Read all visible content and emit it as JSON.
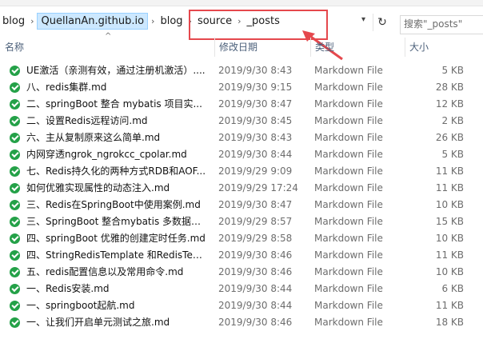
{
  "breadcrumbs": [
    "blog",
    "QuellanAn.github.io",
    "blog",
    "source",
    "_posts"
  ],
  "search": {
    "placeholder": "搜索\"_posts\""
  },
  "columns": {
    "name": "名称",
    "date": "修改日期",
    "type": "类型",
    "size": "大小"
  },
  "colors": {
    "highlight": "#e5484d",
    "check": "#24a148",
    "header_text": "#4c607a"
  },
  "icons": {
    "file": "green-check-icon",
    "refresh": "refresh-icon",
    "dropdown": "chevron-down-icon"
  },
  "files": [
    {
      "name": "UE激活（亲测有效，通过注册机激活）....",
      "date": "2019/9/30 8:43",
      "type": "Markdown File",
      "size": "5 KB"
    },
    {
      "name": "八、redis集群.md",
      "date": "2019/9/30 9:15",
      "type": "Markdown File",
      "size": "28 KB"
    },
    {
      "name": "二、springBoot 整合 mybatis 项目实...",
      "date": "2019/9/30 8:47",
      "type": "Markdown File",
      "size": "12 KB"
    },
    {
      "name": "二、设置Redis远程访问.md",
      "date": "2019/9/30 8:45",
      "type": "Markdown File",
      "size": "2 KB"
    },
    {
      "name": "六、主从复制原来这么简单.md",
      "date": "2019/9/30 8:43",
      "type": "Markdown File",
      "size": "26 KB"
    },
    {
      "name": "内网穿透ngrok_ngrokcc_cpolar.md",
      "date": "2019/9/30 8:44",
      "type": "Markdown File",
      "size": "5 KB"
    },
    {
      "name": "七、Redis持久化的两种方式RDB和AOF...",
      "date": "2019/9/29 9:09",
      "type": "Markdown File",
      "size": "11 KB"
    },
    {
      "name": "如何优雅实现属性的动态注入.md",
      "date": "2019/9/29 17:24",
      "type": "Markdown File",
      "size": "11 KB"
    },
    {
      "name": "三、Redis在SpringBoot中使用案例.md",
      "date": "2019/9/30 8:47",
      "type": "Markdown File",
      "size": "10 KB"
    },
    {
      "name": "三、SpringBoot 整合mybatis 多数据源...",
      "date": "2019/9/29 8:57",
      "type": "Markdown File",
      "size": "15 KB"
    },
    {
      "name": "四、springBoot 优雅的创建定时任务.md",
      "date": "2019/9/29 8:58",
      "type": "Markdown File",
      "size": "10 KB"
    },
    {
      "name": "四、StringRedisTemplate 和RedisTem...",
      "date": "2019/9/30 8:46",
      "type": "Markdown File",
      "size": "11 KB"
    },
    {
      "name": "五、redis配置信息以及常用命令.md",
      "date": "2019/9/30 8:46",
      "type": "Markdown File",
      "size": "10 KB"
    },
    {
      "name": "一、Redis安装.md",
      "date": "2019/9/30 8:44",
      "type": "Markdown File",
      "size": "6 KB"
    },
    {
      "name": "一、springboot起航.md",
      "date": "2019/9/30 8:44",
      "type": "Markdown File",
      "size": "11 KB"
    },
    {
      "name": "一、让我们开启单元测试之旅.md",
      "date": "2019/9/30 8:46",
      "type": "Markdown File",
      "size": "18 KB"
    }
  ]
}
